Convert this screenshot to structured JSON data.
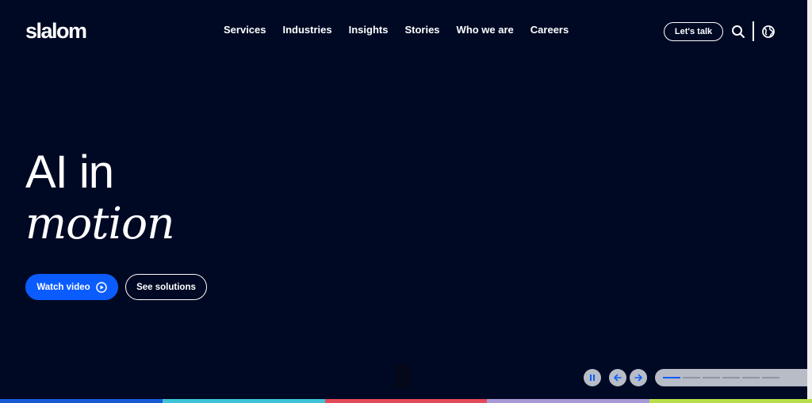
{
  "header": {
    "logo": "slalom",
    "nav": [
      "Services",
      "Industries",
      "Insights",
      "Stories",
      "Who we are",
      "Careers"
    ],
    "cta_label": "Let's talk"
  },
  "hero": {
    "line1": "AI in",
    "line2": "motion",
    "primary_button": "Watch video",
    "secondary_button": "See solutions"
  },
  "carousel": {
    "slide_count": 6,
    "active_slide": 1
  },
  "colors": {
    "background": "#000924",
    "accent": "#0b5cff",
    "band": [
      "#1a5ad6",
      "#3fc4d8",
      "#e34a5a",
      "#a99ad6",
      "#b8df4a"
    ]
  },
  "icons": {
    "search": "search-icon",
    "globe": "globe-icon",
    "play": "play-circle-icon",
    "pause": "pause-icon",
    "prev": "arrow-left-icon",
    "next": "arrow-right-icon"
  }
}
